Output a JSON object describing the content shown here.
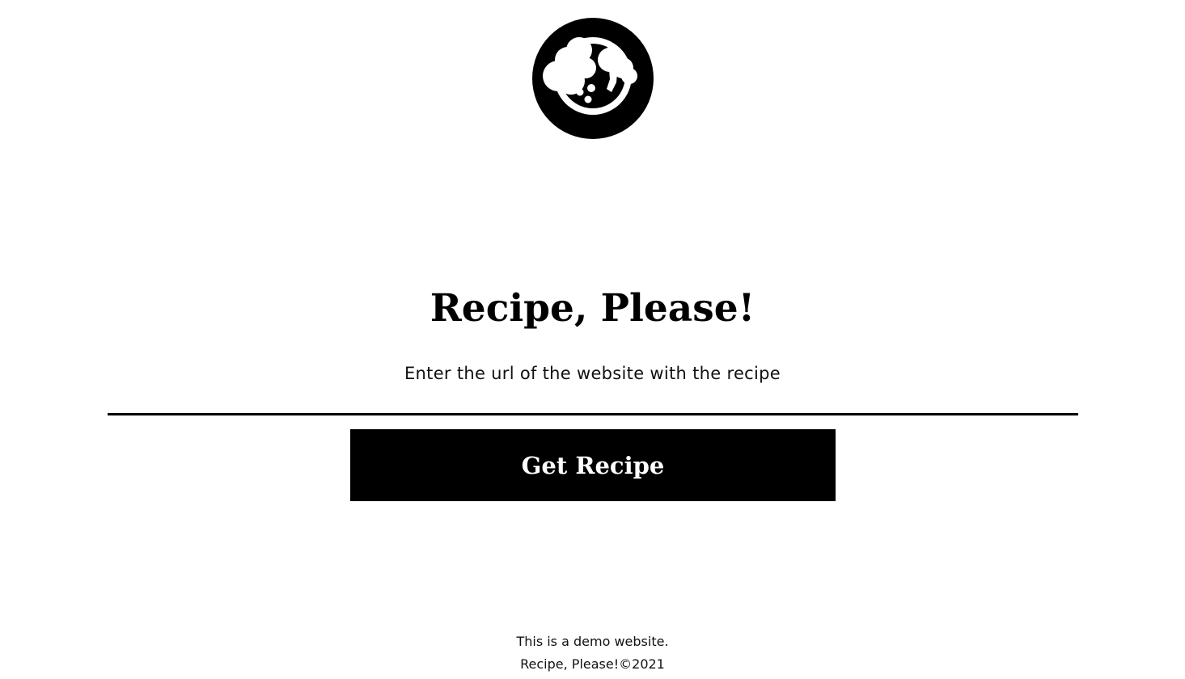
{
  "logo": {
    "icon": "cooking-pot-icon"
  },
  "header": {
    "title": "Recipe, Please!"
  },
  "main": {
    "subtitle": "Enter the url of the website with the recipe",
    "url_input": {
      "value": "",
      "placeholder": ""
    },
    "submit_label": "Get Recipe"
  },
  "footer": {
    "line1": "This is a demo website.",
    "line2": "Recipe, Please!©2021"
  },
  "colors": {
    "background": "#ffffff",
    "accent": "#000000",
    "button_text": "#ffffff"
  }
}
